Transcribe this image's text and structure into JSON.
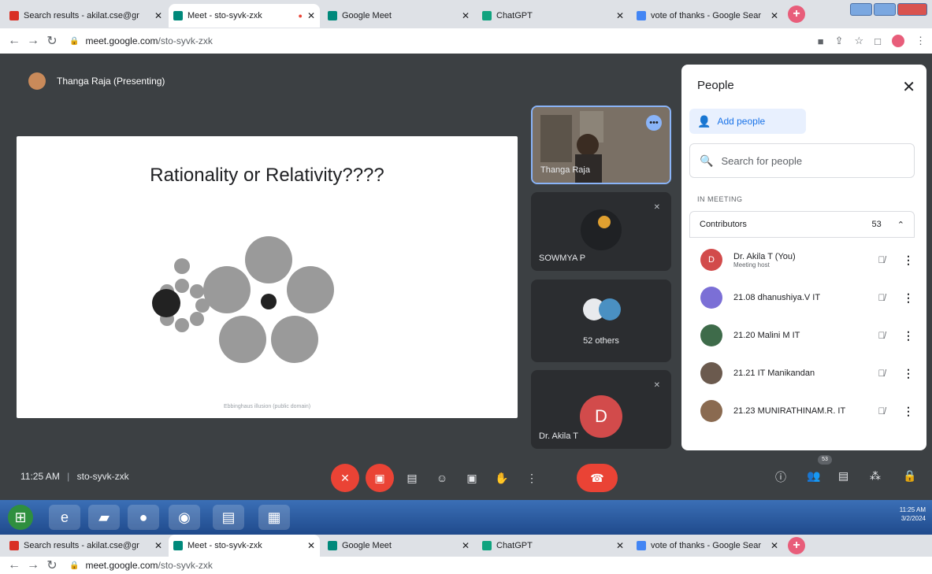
{
  "browser": {
    "tabs": [
      {
        "title": "Search results - akilat.cse@gr",
        "favicon": "gmail-icon",
        "color": "#d93025",
        "active": false
      },
      {
        "title": "Meet - sto-syvk-zxk",
        "favicon": "meet-icon",
        "color": "#00897b",
        "active": true
      },
      {
        "title": "Google Meet",
        "favicon": "meet-icon",
        "color": "#00897b",
        "active": false
      },
      {
        "title": "ChatGPT",
        "favicon": "chatgpt-icon",
        "color": "#10a37f",
        "active": false
      },
      {
        "title": "vote of thanks - Google Sear",
        "favicon": "google-icon",
        "color": "#4285f4",
        "active": false
      }
    ],
    "url_host": "meet.google.com",
    "url_path": "/sto-syvk-zxk"
  },
  "meet": {
    "presenter_label": "Thanga Raja (Presenting)",
    "slide_title": "Rationality or Relativity????",
    "slide_footer": "Ebbinghaus illusion (public domain)",
    "tiles": [
      {
        "name": "Thanga Raja"
      },
      {
        "name": "SOWMYA P"
      },
      {
        "name": "52 others"
      },
      {
        "name": "Dr. Akila T",
        "initial": "D"
      }
    ],
    "time": "11:25 AM",
    "separator": "|",
    "meeting_code": "sto-syvk-zxk",
    "participant_count": "53"
  },
  "people": {
    "title": "People",
    "add_label": "Add people",
    "search_placeholder": "Search for people",
    "section": "IN MEETING",
    "group_label": "Contributors",
    "group_count": "53",
    "list": [
      {
        "name": "Dr. Akila T (You)",
        "sub": "Meeting host",
        "initial": "D",
        "color": "#d24b4b"
      },
      {
        "name": "21.08 dhanushiya.V IT",
        "sub": "",
        "initial": "",
        "color": "#7b6fd6"
      },
      {
        "name": "21.20 Malini M IT",
        "sub": "",
        "initial": "",
        "color": "#3e6b4a"
      },
      {
        "name": "21.21 IT Manikandan",
        "sub": "",
        "initial": "",
        "color": "#6b5a4e"
      },
      {
        "name": "21.23 MUNIRATHINAM.R. IT",
        "sub": "",
        "initial": "",
        "color": "#8a6a50"
      }
    ]
  },
  "taskbar": {
    "time": "11:25 AM",
    "date": "3/2/2024"
  },
  "colors": {
    "meet_bg": "#3c4043",
    "accent_blue": "#1a73e8",
    "end_red": "#ea4335"
  }
}
